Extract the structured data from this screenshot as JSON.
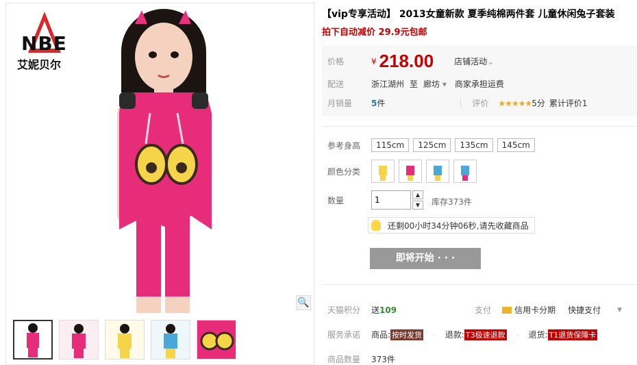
{
  "brand": {
    "logo_en": "NBE",
    "logo_cn": "艾妮贝尔"
  },
  "title": "【vip专享活动】 2013女童新款 夏季纯棉两件套 儿童休闲兔子套装",
  "promo": "拍下自动减价 29.9元包邮",
  "price": {
    "label": "价格",
    "currency": "¥",
    "value": "218.00",
    "shop_activity": "店铺活动"
  },
  "delivery": {
    "label": "配送",
    "from": "浙江湖州",
    "to_word": "至",
    "to": "廊坊",
    "fee": "商家承担运费"
  },
  "monthly_sales": {
    "label": "月销量",
    "value": "5",
    "unit": "件",
    "rating_label": "评价",
    "stars": "★★★★★",
    "score": "5分",
    "review_count": "累计评价1"
  },
  "size": {
    "label": "参考身高",
    "options": [
      "115cm",
      "125cm",
      "135cm",
      "145cm"
    ]
  },
  "color": {
    "label": "颜色分类"
  },
  "quantity": {
    "label": "数量",
    "value": "1",
    "stock": "库存373件",
    "up": "▲",
    "down": "▼"
  },
  "countdown": "还剩00小时34分钟06秒,请先收藏商品",
  "buy_button": "即将开始 · · ·",
  "points": {
    "label": "天猫积分",
    "give": "送",
    "value": "109",
    "pay_label": "支付",
    "pay1": "信用卡分期",
    "pay2": "快捷支付",
    "pay_more": "▼"
  },
  "service": {
    "label": "服务承诺",
    "goods": "商品:",
    "goods_tag": "按时发货",
    "refund": "退款:",
    "refund_tag": "T3极速退款",
    "return": "退货:",
    "return_tag": "T1退货保障卡"
  },
  "stock_count": {
    "label": "商品数量",
    "value": "373件"
  },
  "icons": {
    "zoom": "🔍",
    "delivery_arrow": "▾",
    "activity_arrow": "⌄"
  }
}
